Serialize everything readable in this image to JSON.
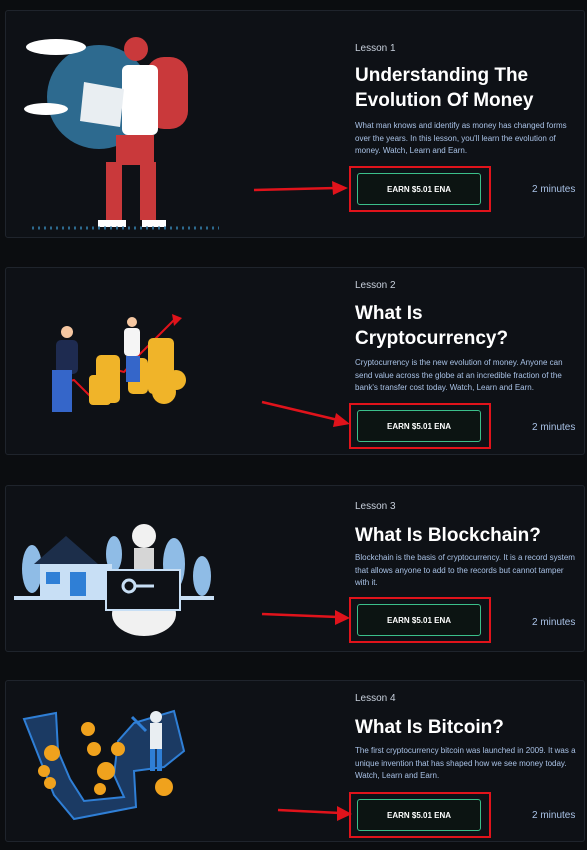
{
  "lessons": [
    {
      "lesson_label": "Lesson 1",
      "title": "Understanding The Evolution Of Money",
      "description": "What man knows and identify as money has changed forms over the years. In this lesson, you'll learn the evolution of money. Watch, Learn and Earn.",
      "earn_label": "EARN $5.01 ENA",
      "duration": "2 minutes",
      "illustration_icon": "traveler-with-map-icon"
    },
    {
      "lesson_label": "Lesson 2",
      "title": "What Is Cryptocurrency?",
      "description": "Cryptocurrency is the new evolution of money. Anyone can send value across the globe at an incredible fraction of the bank's transfer cost today. Watch, Learn and Earn.",
      "earn_label": "EARN $5.01 ENA",
      "duration": "2 minutes",
      "illustration_icon": "coin-stacks-growth-icon"
    },
    {
      "lesson_label": "Lesson 3",
      "title": "What Is Blockchain?",
      "description": "Blockchain is the basis of cryptocurrency. It is a record system that allows anyone to add to the records but cannot tamper with it.",
      "earn_label": "EARN $5.01 ENA",
      "duration": "2 minutes",
      "illustration_icon": "house-and-key-icon"
    },
    {
      "lesson_label": "Lesson 4",
      "title": "What Is Bitcoin?",
      "description": "The first cryptocurrency bitcoin was launched in 2009. It was a unique invention that has shaped how we see money today. Watch, Learn and Earn.",
      "earn_label": "EARN $5.01 ENA",
      "duration": "2 minutes",
      "illustration_icon": "bitcoin-mining-icon"
    }
  ],
  "colors": {
    "page_bg": "#0b0d10",
    "card_bg": "#0e1116",
    "card_border": "#1f242c",
    "button_border": "#3bbf8a",
    "highlight_red": "#e0131b",
    "desc_text": "#a9c2e6"
  }
}
